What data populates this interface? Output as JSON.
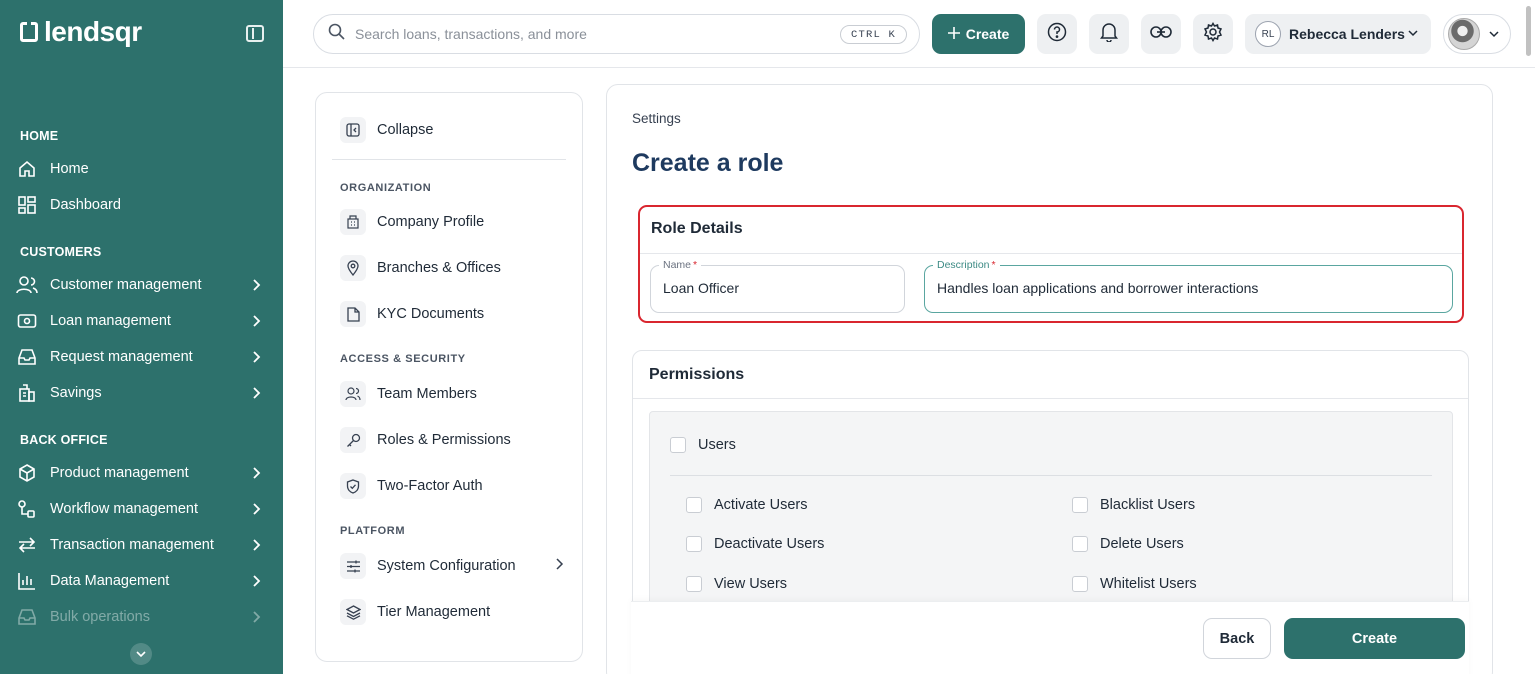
{
  "brand": {
    "name": "lendsqr"
  },
  "sidebar": {
    "sections": [
      {
        "title": "HOME"
      },
      {
        "title": "CUSTOMERS"
      },
      {
        "title": "BACK OFFICE"
      }
    ],
    "items": [
      {
        "label": "Home",
        "icon": "home-icon"
      },
      {
        "label": "Dashboard",
        "icon": "dashboard-icon"
      },
      {
        "label": "Customer management",
        "icon": "users-icon"
      },
      {
        "label": "Loan management",
        "icon": "loan-icon"
      },
      {
        "label": "Request management",
        "icon": "inbox-icon"
      },
      {
        "label": "Savings",
        "icon": "bank-icon"
      },
      {
        "label": "Product management",
        "icon": "cube-icon"
      },
      {
        "label": "Workflow management",
        "icon": "workflow-icon"
      },
      {
        "label": "Transaction management",
        "icon": "transfer-icon"
      },
      {
        "label": "Data Management",
        "icon": "bar-chart-icon"
      },
      {
        "label": "Bulk operations",
        "icon": "tray-icon"
      }
    ]
  },
  "topbar": {
    "search_placeholder": "Search loans, transactions, and more",
    "shortcut": "CTRL K",
    "create_label": "Create",
    "user_initials": "RL",
    "user_name": "Rebecca Lenders"
  },
  "subnav": {
    "collapse_label": "Collapse",
    "sections": {
      "organization": "ORGANIZATION",
      "access": "ACCESS & SECURITY",
      "platform": "PLATFORM"
    },
    "items": [
      {
        "label": "Company Profile",
        "icon": "building-icon"
      },
      {
        "label": "Branches & Offices",
        "icon": "location-pin-icon"
      },
      {
        "label": "KYC Documents",
        "icon": "document-icon"
      },
      {
        "label": "Team Members",
        "icon": "team-icon"
      },
      {
        "label": "Roles & Permissions",
        "icon": "key-icon"
      },
      {
        "label": "Two-Factor Auth",
        "icon": "shield-icon"
      },
      {
        "label": "System Configuration",
        "icon": "sliders-icon"
      },
      {
        "label": "Tier Management",
        "icon": "layers-icon"
      }
    ]
  },
  "main": {
    "breadcrumb": "Settings",
    "title": "Create a role",
    "role_details": {
      "title": "Role Details",
      "name_label": "Name",
      "name_value": "Loan Officer",
      "description_label": "Description",
      "description_value": "Handles loan applications and borrower interactions",
      "required_mark": "*"
    },
    "permissions": {
      "title": "Permissions",
      "group_label": "Users",
      "items": [
        "Activate Users",
        "Blacklist Users",
        "Deactivate Users",
        "Delete Users",
        "View Users",
        "Whitelist Users"
      ]
    },
    "footer": {
      "back_label": "Back",
      "create_label": "Create"
    }
  },
  "colors": {
    "brand": "#2d716c",
    "highlight": "#d9262f",
    "title": "#1e3a5f"
  }
}
